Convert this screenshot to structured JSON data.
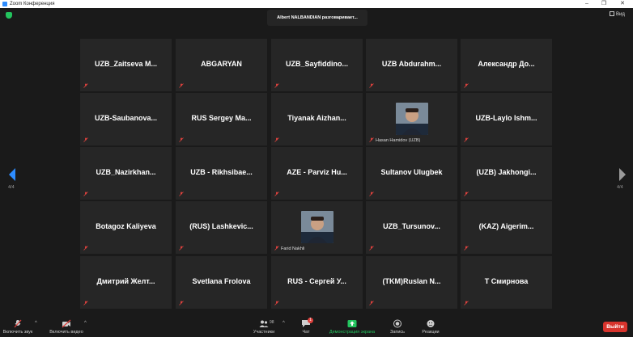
{
  "window": {
    "title": "Zoom Конференция"
  },
  "speaker_banner": "Albert NALBANDIAN разговаривает...",
  "view_label": "Вид",
  "page_indicator": {
    "left": "4/4",
    "right": "4/4"
  },
  "colors": {
    "accent_green": "#23c45e",
    "leave_red": "#d8342d",
    "mute_red": "#e0423e"
  },
  "participants": [
    {
      "name": "UZB_Zaitseva M..."
    },
    {
      "name": "ABGARYAN"
    },
    {
      "name": "UZB_Sayfiddino..."
    },
    {
      "name": "UZB Abdurahm..."
    },
    {
      "name": "Александр До..."
    },
    {
      "name": "UZB-Saubanova..."
    },
    {
      "name": "RUS Sergey Ma..."
    },
    {
      "name": "Tiyanak Aizhan..."
    },
    {
      "caption": "Hasan Hamidov (UZB)",
      "photo": true
    },
    {
      "name": "UZB-Laylo Ishm..."
    },
    {
      "name": "UZB_Nazirkhan..."
    },
    {
      "name": "UZB - Rikhsibae..."
    },
    {
      "name": "AZE - Parviz Hu..."
    },
    {
      "name": "Sultanov Ulugbek"
    },
    {
      "name": "(UZB) Jakhongi..."
    },
    {
      "name": "Botagoz Kaliyeva"
    },
    {
      "name": "(RUS) Lashkevic..."
    },
    {
      "caption": "Farid Nakhli",
      "photo": true
    },
    {
      "name": "UZB_Tursunov..."
    },
    {
      "name": "(KAZ) Aigerim..."
    },
    {
      "name": "Дмитрий Желт..."
    },
    {
      "name": "Svetlana Frolova"
    },
    {
      "name": "RUS - Сергей У..."
    },
    {
      "name": "(TKM)Ruslan N..."
    },
    {
      "name": "Т Смирнова"
    }
  ],
  "toolbar": {
    "unmute": "Включить звук",
    "start_video": "Включить видео",
    "participants": "Участники",
    "participants_count": "98",
    "chat": "Чат",
    "chat_badge": "1",
    "share_screen": "Демонстрация экрана",
    "record": "Запись",
    "reactions": "Реакции",
    "leave": "Выйти"
  }
}
